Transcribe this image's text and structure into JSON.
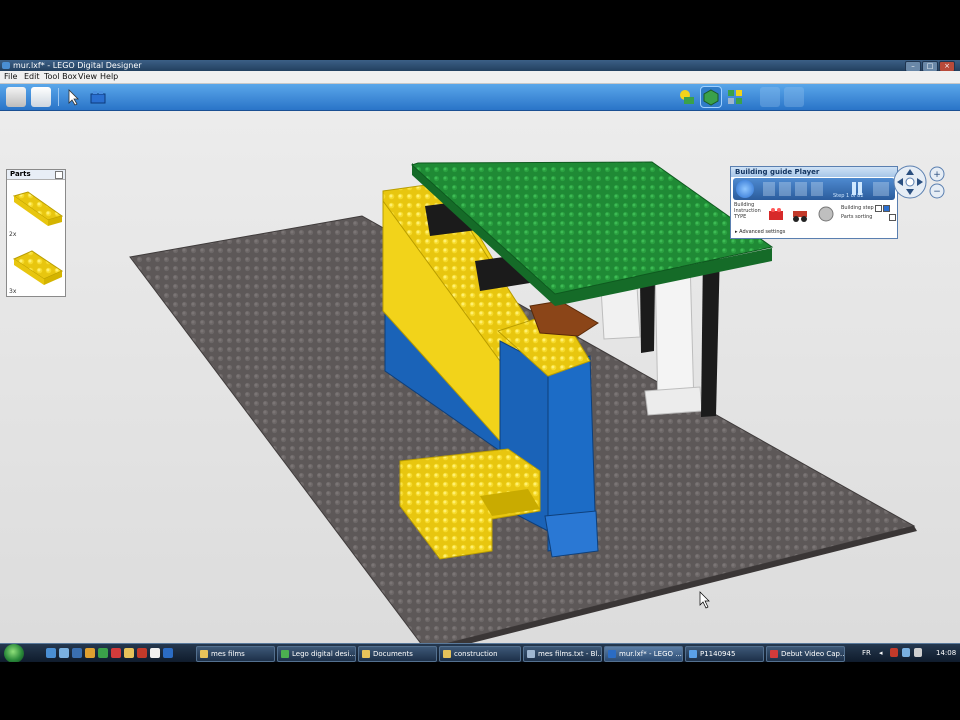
{
  "window": {
    "title": "mur.lxf* - LEGO Digital Designer"
  },
  "menu": [
    "File",
    "Edit",
    "Tool Box",
    "View",
    "Help"
  ],
  "toolbar": {
    "left_tools": [
      "print-icon",
      "export-icon",
      "select-tool-icon",
      "brick-tool-icon"
    ],
    "mode_buttons": [
      "build-mode-icon",
      "view-mode-icon",
      "guide-mode-icon"
    ]
  },
  "parts_panel": {
    "title": "Parts",
    "items": [
      {
        "icon": "yellow-brick-2x6",
        "count": "2x"
      },
      {
        "icon": "yellow-brick-2x4",
        "count": "3x"
      }
    ]
  },
  "guide_panel": {
    "title": "Building guide Player",
    "step_display": "Step 1 of 82",
    "label_building": "Building",
    "label_instruction": "Instruction",
    "label_type": "TYPE",
    "option_1": "Building step",
    "option_2": "Parts sorting",
    "advanced": "Advanced settings"
  },
  "taskbar": {
    "tasks": [
      {
        "label": "mes films",
        "color": "#e6c25a"
      },
      {
        "label": "Lego digital desi...",
        "color": "#4caf50"
      },
      {
        "label": "Documents",
        "color": "#e6c25a"
      },
      {
        "label": "construction",
        "color": "#e6c25a"
      },
      {
        "label": "mes films.txt - Bl...",
        "color": "#9fb6d0"
      },
      {
        "label": "mur.lxf* - LEGO ...",
        "color": "#2b6cc4"
      },
      {
        "label": "P1140945",
        "color": "#5aa0e8"
      },
      {
        "label": "Debut Video Cap...",
        "color": "#d23b3b"
      }
    ],
    "language": "FR",
    "clock": "14:08"
  },
  "colors": {
    "baseplate": "#5d5858",
    "roof": "#1f8a35",
    "yellow": "#f2d31a",
    "blue": "#1a63b8",
    "white": "#f2f2f2",
    "black": "#1b1b1b",
    "brown": "#8b4518"
  }
}
